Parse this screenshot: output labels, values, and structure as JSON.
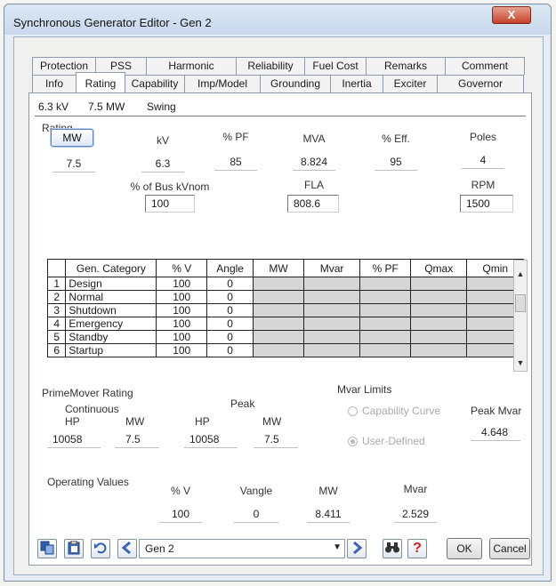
{
  "window": {
    "title": "Synchronous Generator Editor - Gen 2",
    "close_label": "X"
  },
  "tabs_row1": [
    "Protection",
    "PSS",
    "Harmonic",
    "Reliability",
    "Fuel Cost",
    "Remarks",
    "Comment"
  ],
  "tabs_row2": [
    "Info",
    "Rating",
    "Capability",
    "Imp/Model",
    "Grounding",
    "Inertia",
    "Exciter",
    "Governor"
  ],
  "active_tab": "Rating",
  "summary": {
    "kv": "6.3 kV",
    "mw": "7.5 MW",
    "mode": "Swing"
  },
  "rating": {
    "section_label": "Rating",
    "mw_button": "MW",
    "mw_value": "7.5",
    "kv_label": "kV",
    "kv_value": "6.3",
    "pf_label": "% PF",
    "pf_value": "85",
    "mva_label": "MVA",
    "mva_value": "8.824",
    "eff_label": "% Eff.",
    "eff_value": "95",
    "poles_label": "Poles",
    "poles_value": "4",
    "bus_kvnom_label": "% of Bus kVnom",
    "bus_kvnom_value": "100",
    "fla_label": "FLA",
    "fla_value": "808.6",
    "rpm_label": "RPM",
    "rpm_value": "1500"
  },
  "grid": {
    "headers": [
      "Gen. Category",
      "% V",
      "Angle",
      "MW",
      "Mvar",
      "% PF",
      "Qmax",
      "Qmin"
    ],
    "rows": [
      {
        "idx": "1",
        "category": "Design",
        "v": "100",
        "angle": "0"
      },
      {
        "idx": "2",
        "category": "Normal",
        "v": "100",
        "angle": "0"
      },
      {
        "idx": "3",
        "category": "Shutdown",
        "v": "100",
        "angle": "0"
      },
      {
        "idx": "4",
        "category": "Emergency",
        "v": "100",
        "angle": "0"
      },
      {
        "idx": "5",
        "category": "Standby",
        "v": "100",
        "angle": "0"
      },
      {
        "idx": "6",
        "category": "Startup",
        "v": "100",
        "angle": "0"
      }
    ]
  },
  "primemover": {
    "section_label": "PrimeMover Rating",
    "continuous_label": "Continuous",
    "peak_label": "Peak",
    "hp_label": "HP",
    "mw_label": "MW",
    "cont_hp": "10058",
    "cont_mw": "7.5",
    "peak_hp": "10058",
    "peak_mw": "7.5"
  },
  "mvar_limits": {
    "section_label": "Mvar Limits",
    "capability_curve": "Capability Curve",
    "user_defined": "User-Defined",
    "peak_mvar_label": "Peak Mvar",
    "peak_mvar_value": "4.648"
  },
  "operating": {
    "section_label": "Operating Values",
    "v_label": "% V",
    "v_value": "100",
    "vangle_label": "Vangle",
    "vangle_value": "0",
    "mw_label": "MW",
    "mw_value": "8.411",
    "mvar_label": "Mvar",
    "mvar_value": "2.529"
  },
  "bottom": {
    "selector_value": "Gen 2",
    "help_label": "?",
    "ok_label": "OK",
    "cancel_label": "Cancel"
  },
  "colors": {
    "accent": "#5b84c4",
    "help_red": "#d42020",
    "nav_blue": "#3b63b8"
  }
}
